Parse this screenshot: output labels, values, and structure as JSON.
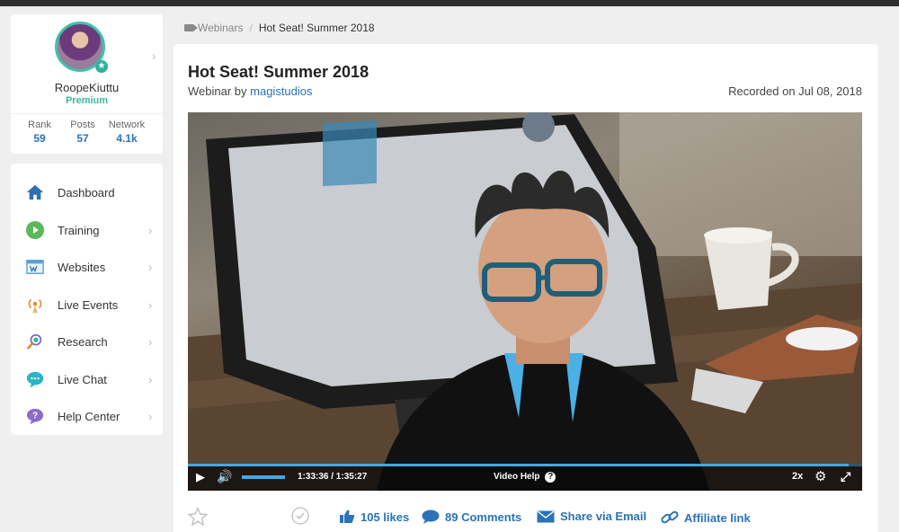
{
  "profile": {
    "username": "RoopeKiuttu",
    "tier": "Premium",
    "stats": [
      {
        "label": "Rank",
        "value": "59"
      },
      {
        "label": "Posts",
        "value": "57"
      },
      {
        "label": "Network",
        "value": "4.1k"
      }
    ]
  },
  "sidebar": {
    "items": [
      {
        "label": "Dashboard",
        "icon": "home-icon"
      },
      {
        "label": "Training",
        "icon": "play-circle-icon"
      },
      {
        "label": "Websites",
        "icon": "website-icon"
      },
      {
        "label": "Live Events",
        "icon": "broadcast-icon"
      },
      {
        "label": "Research",
        "icon": "research-icon"
      },
      {
        "label": "Live Chat",
        "icon": "chat-icon"
      },
      {
        "label": "Help Center",
        "icon": "question-icon"
      }
    ]
  },
  "breadcrumb": {
    "section": "Webinars",
    "separator": "/",
    "current": "Hot Seat! Summer 2018"
  },
  "webinar": {
    "title": "Hot Seat! Summer 2018",
    "by_prefix": "Webinar by",
    "author": "magistudios",
    "recorded": "Recorded on Jul 08, 2018"
  },
  "player": {
    "time": "1:33:36 / 1:35:27",
    "help_label": "Video Help",
    "speed": "2x",
    "progress_fraction": 0.98,
    "volume_fraction": 1.0
  },
  "actions": {
    "likes": "105 likes",
    "comments": "89 Comments",
    "share": "Share via Email",
    "affiliate": "Affiliate link"
  },
  "colors": {
    "accent": "#2a73b8",
    "premium": "#3cb89c",
    "progress": "#49a6dc"
  }
}
